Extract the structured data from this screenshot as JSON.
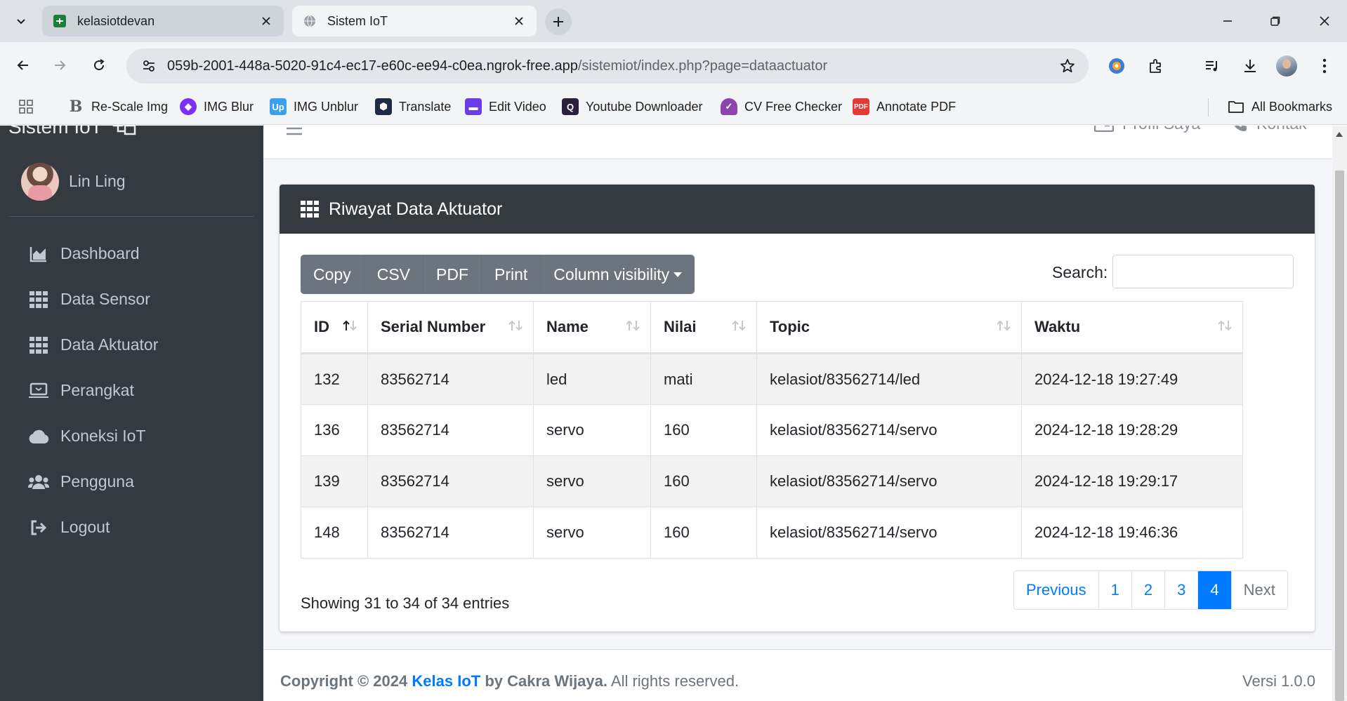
{
  "browser": {
    "tabs": [
      {
        "title": "kelasiotdevan",
        "active": false
      },
      {
        "title": "Sistem IoT",
        "active": true
      }
    ],
    "url_host": "059b-2001-448a-5020-91c4-ec17-e60c-ee94-c0ea.ngrok-free.app",
    "url_path": "/sistemiot/index.php?page=dataactuator",
    "bookmarks": [
      {
        "label": "Re-Scale Img",
        "icon": "rescale-icon"
      },
      {
        "label": "IMG Blur",
        "icon": "img-blur-icon"
      },
      {
        "label": "IMG Unblur",
        "icon": "img-unblur-icon"
      },
      {
        "label": "Translate",
        "icon": "translate-icon"
      },
      {
        "label": "Edit Video",
        "icon": "edit-video-icon"
      },
      {
        "label": "Youtube Downloader",
        "icon": "youtube-downloader-icon"
      },
      {
        "label": "CV Free Checker",
        "icon": "cv-checker-icon"
      },
      {
        "label": "Annotate PDF",
        "icon": "pdf-icon"
      }
    ],
    "all_bookmarks": "All Bookmarks"
  },
  "sidebar": {
    "brand": "Sistem IoT",
    "user_name": "Lin Ling",
    "items": [
      {
        "label": "Dashboard",
        "icon": "chart-area-icon"
      },
      {
        "label": "Data Sensor",
        "icon": "grid-icon"
      },
      {
        "label": "Data Aktuator",
        "icon": "grid-icon"
      },
      {
        "label": "Perangkat",
        "icon": "laptop-icon"
      },
      {
        "label": "Koneksi IoT",
        "icon": "cloud-icon"
      },
      {
        "label": "Pengguna",
        "icon": "users-icon"
      },
      {
        "label": "Logout",
        "icon": "logout-icon"
      }
    ]
  },
  "topnav": {
    "profile": "Profil Saya",
    "contact": "Kontak"
  },
  "card": {
    "title": "Riwayat Data Aktuator",
    "buttons": [
      "Copy",
      "CSV",
      "PDF",
      "Print",
      "Column visibility"
    ],
    "search_label": "Search:",
    "search_value": "",
    "columns": [
      "ID",
      "Serial Number",
      "Name",
      "Nilai",
      "Topic",
      "Waktu"
    ],
    "rows": [
      [
        "132",
        "83562714",
        "led",
        "mati",
        "kelasiot/83562714/led",
        "2024-12-18 19:27:49"
      ],
      [
        "136",
        "83562714",
        "servo",
        "160",
        "kelasiot/83562714/servo",
        "2024-12-18 19:28:29"
      ],
      [
        "139",
        "83562714",
        "servo",
        "160",
        "kelasiot/83562714/servo",
        "2024-12-18 19:29:17"
      ],
      [
        "148",
        "83562714",
        "servo",
        "160",
        "kelasiot/83562714/servo",
        "2024-12-18 19:46:36"
      ]
    ],
    "info": "Showing 31 to 34 of 34 entries",
    "pagination": {
      "previous": "Previous",
      "pages": [
        "1",
        "2",
        "3",
        "4"
      ],
      "active": "4",
      "next": "Next"
    }
  },
  "footer": {
    "prefix": "Copyright © 2024",
    "link": "Kelas IoT",
    "by": "by Cakra Wijaya.",
    "suffix": "All rights reserved.",
    "version": "Versi 1.0.0"
  },
  "colors": {
    "sidebar": "#343a40",
    "primary": "#007bff",
    "secondary": "#6c757d"
  }
}
